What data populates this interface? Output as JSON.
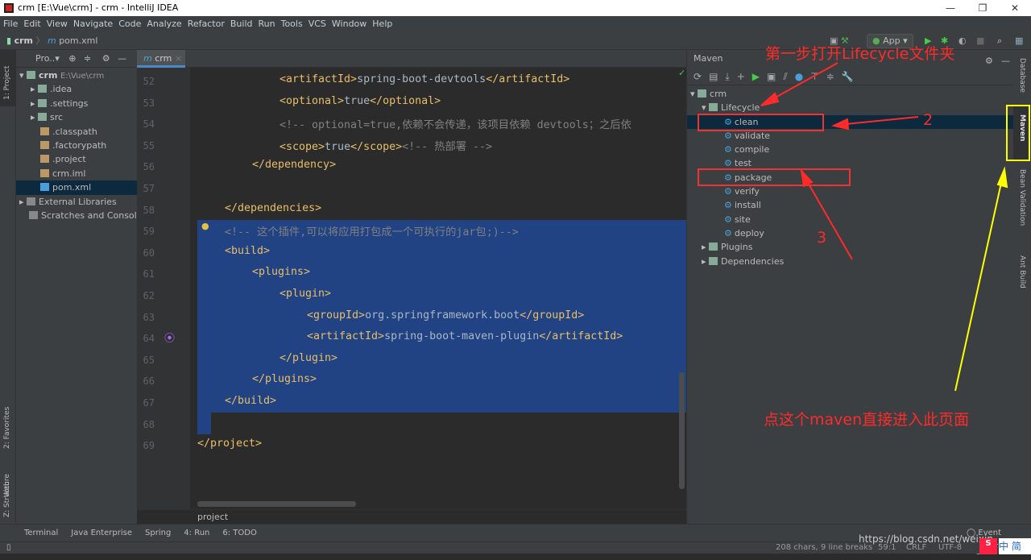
{
  "window": {
    "title": "crm [E:\\Vue\\crm] - crm - IntelliJ IDEA"
  },
  "menu": [
    "File",
    "Edit",
    "View",
    "Navigate",
    "Code",
    "Analyze",
    "Refactor",
    "Build",
    "Run",
    "Tools",
    "VCS",
    "Window",
    "Help"
  ],
  "nav": {
    "project": "crm",
    "file": "pom.xml",
    "run_config": "App"
  },
  "left_stripe": {
    "project": "1: Project",
    "favorites": "2: Favorites",
    "web": "Web",
    "structure": "Z: Structure"
  },
  "project_panel": {
    "title": "Pro..▾",
    "root": "crm",
    "root_path": "E:\\Vue\\crm",
    "items": [
      ".idea",
      ".settings",
      "src",
      ".classpath",
      ".factorypath",
      ".project",
      "crm.iml",
      "pom.xml"
    ],
    "external": "External Libraries",
    "scratches": "Scratches and Consoles"
  },
  "editor": {
    "tab": "crm",
    "breadcrumb": "project",
    "lines": [
      {
        "n": "52",
        "indent": 3,
        "parts": [
          [
            "tag",
            "<artifactId>"
          ],
          [
            "t",
            "spring-boot-devtools"
          ],
          [
            "tag",
            "</artifactId>"
          ]
        ]
      },
      {
        "n": "53",
        "indent": 3,
        "parts": [
          [
            "tag",
            "<optional>"
          ],
          [
            "t",
            "true"
          ],
          [
            "tag",
            "</optional>"
          ]
        ]
      },
      {
        "n": "54",
        "indent": 3,
        "parts": [
          [
            "cm",
            "<!-- optional=true,依赖不会传递，该项目依赖 devtools；之后依"
          ]
        ]
      },
      {
        "n": "55",
        "indent": 3,
        "parts": [
          [
            "tag",
            "<scope>"
          ],
          [
            "t",
            "true"
          ],
          [
            "tag",
            "</scope>"
          ],
          [
            "cm",
            "<!-- 热部署 -->"
          ]
        ]
      },
      {
        "n": "56",
        "indent": 2,
        "parts": [
          [
            "tag",
            "</dependency>"
          ]
        ]
      },
      {
        "n": "57",
        "indent": 0,
        "parts": []
      },
      {
        "n": "58",
        "indent": 1,
        "parts": [
          [
            "tag",
            "</dependencies>"
          ]
        ]
      },
      {
        "n": "59",
        "indent": 1,
        "parts": [
          [
            "cm",
            "<!-- 这个插件,可以将应用打包成一个可执行的jar包;)-->"
          ]
        ]
      },
      {
        "n": "60",
        "indent": 1,
        "parts": [
          [
            "tag",
            "<build>"
          ]
        ]
      },
      {
        "n": "61",
        "indent": 2,
        "parts": [
          [
            "tag",
            "<plugins>"
          ]
        ]
      },
      {
        "n": "62",
        "indent": 3,
        "parts": [
          [
            "tag",
            "<plugin>"
          ]
        ]
      },
      {
        "n": "63",
        "indent": 4,
        "parts": [
          [
            "tag",
            "<groupId>"
          ],
          [
            "t",
            "org.springframework.boot"
          ],
          [
            "tag",
            "</groupId>"
          ]
        ]
      },
      {
        "n": "64",
        "indent": 4,
        "parts": [
          [
            "tag",
            "<artifactId>"
          ],
          [
            "t",
            "spring-boot-maven-plugin"
          ],
          [
            "tag",
            "</artifactId>"
          ]
        ]
      },
      {
        "n": "65",
        "indent": 3,
        "parts": [
          [
            "tag",
            "</plugin>"
          ]
        ]
      },
      {
        "n": "66",
        "indent": 2,
        "parts": [
          [
            "tag",
            "</plugins>"
          ]
        ]
      },
      {
        "n": "67",
        "indent": 1,
        "parts": [
          [
            "tag",
            "</build>"
          ]
        ]
      },
      {
        "n": "68",
        "indent": 0,
        "parts": []
      },
      {
        "n": "69",
        "indent": 0,
        "parts": [
          [
            "tag",
            "</project>"
          ]
        ]
      }
    ]
  },
  "maven": {
    "title": "Maven",
    "root": "crm",
    "lifecycle": "Lifecycle",
    "phases": [
      "clean",
      "validate",
      "compile",
      "test",
      "package",
      "verify",
      "install",
      "site",
      "deploy"
    ],
    "plugins": "Plugins",
    "dependencies": "Dependencies"
  },
  "right_stripe": {
    "database": "Database",
    "maven": "Maven",
    "bean": "Bean Validation",
    "ant": "Ant Build"
  },
  "bottom_tools": [
    "Terminal",
    "Java Enterprise",
    "Spring",
    "4: Run",
    "6: TODO"
  ],
  "event_log": "Event Log",
  "status": {
    "text": "208 chars, 9 line breaks",
    "pos": "59:1",
    "crlf": "CRLF",
    "enc": "UTF-8",
    "watermark": "https://blog.csdn.net/weixin_",
    "ime": "中 简"
  },
  "annotations": {
    "step1": "第一步打开Lifecycle文件夹",
    "n2": "2",
    "n3": "3",
    "maven_hint": "点这个maven直接进入此页面"
  },
  "colors": {
    "annotation": "#ff2a2a",
    "highlight": "#ffff00",
    "selection": "#214283"
  }
}
